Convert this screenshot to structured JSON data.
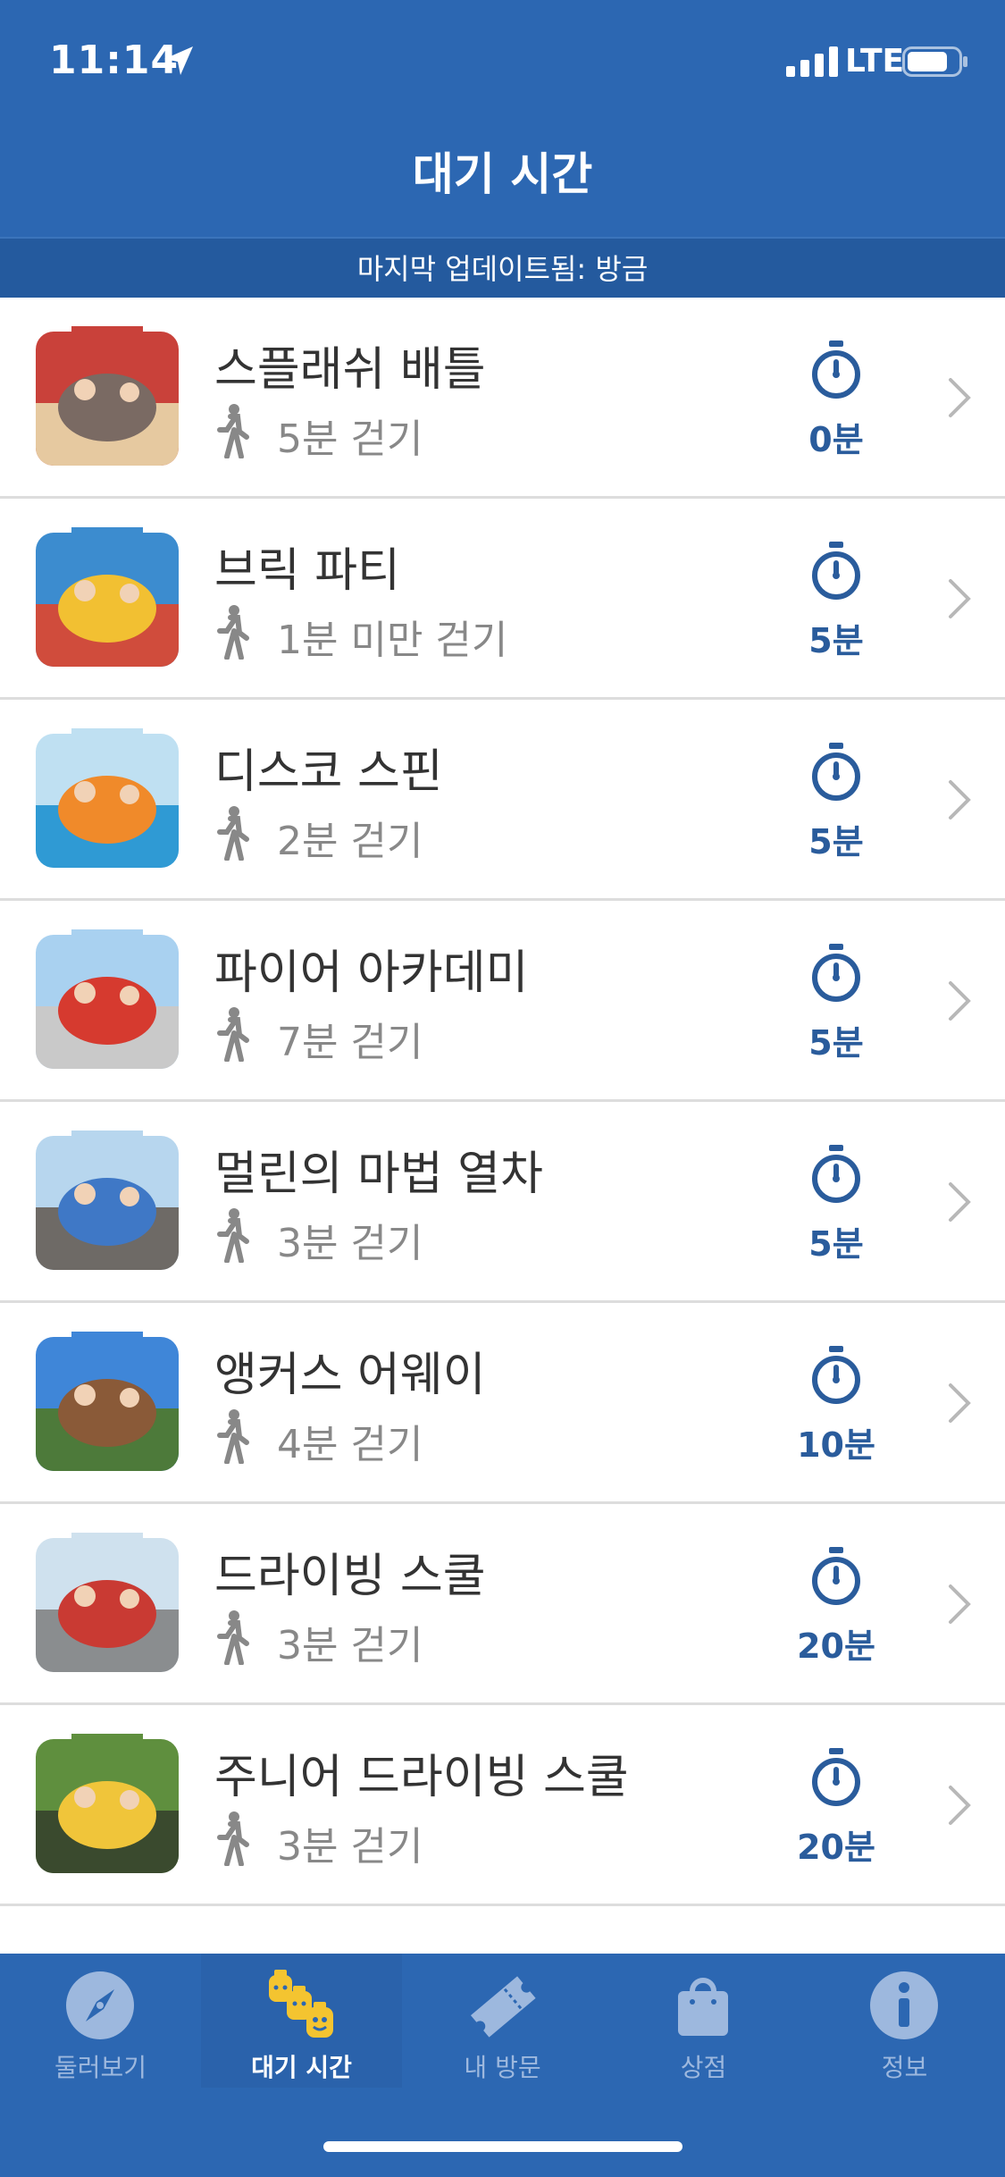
{
  "status_bar": {
    "time": "11:14",
    "network": "LTE"
  },
  "header": {
    "title": "대기 시간"
  },
  "update_bar": {
    "text": "마지막 업데이트됨: 방금"
  },
  "rides": [
    {
      "name": "스플래쉬 배틀",
      "walk": "5분 걷기",
      "wait": "0분",
      "thumb_colors": [
        "#c9413a",
        "#7a6a63",
        "#e6c9a0"
      ]
    },
    {
      "name": "브릭 파티",
      "walk": "1분 미만 걷기",
      "wait": "5분",
      "thumb_colors": [
        "#3c8ccf",
        "#f2c032",
        "#d04c3c"
      ]
    },
    {
      "name": "디스코 스핀",
      "walk": "2분 걷기",
      "wait": "5분",
      "thumb_colors": [
        "#bfe0f2",
        "#f08a2a",
        "#2f9ad4"
      ]
    },
    {
      "name": "파이어 아카데미",
      "walk": "7분 걷기",
      "wait": "5분",
      "thumb_colors": [
        "#a9d1f0",
        "#d63a2f",
        "#c9c9c9"
      ]
    },
    {
      "name": "멀린의 마법 열차",
      "walk": "3분 걷기",
      "wait": "5분",
      "thumb_colors": [
        "#b7d6ee",
        "#3f78c6",
        "#6e6a66"
      ]
    },
    {
      "name": "앵커스 어웨이",
      "walk": "4분 걷기",
      "wait": "10분",
      "thumb_colors": [
        "#3f86d8",
        "#8a5a38",
        "#4d7a3a"
      ]
    },
    {
      "name": "드라이빙 스쿨",
      "walk": "3분 걷기",
      "wait": "20분",
      "thumb_colors": [
        "#cfe1ee",
        "#c93a33",
        "#8a8d8f"
      ]
    },
    {
      "name": "주니어 드라이빙 스쿨",
      "walk": "3분 걷기",
      "wait": "20분",
      "thumb_colors": [
        "#5f8f3e",
        "#f0c53a",
        "#3a4a2e"
      ]
    }
  ],
  "tabs": [
    {
      "label": "둘러보기",
      "icon": "compass-icon",
      "active": false
    },
    {
      "label": "대기 시간",
      "icon": "lego-heads-icon",
      "active": true
    },
    {
      "label": "내 방문",
      "icon": "ticket-icon",
      "active": false
    },
    {
      "label": "상점",
      "icon": "shopping-bag-icon",
      "active": false
    },
    {
      "label": "정보",
      "icon": "info-icon",
      "active": false
    }
  ],
  "colors": {
    "brand_blue": "#2c67b2",
    "wait_blue": "#2a5c9c",
    "walk_gray": "#888888"
  }
}
